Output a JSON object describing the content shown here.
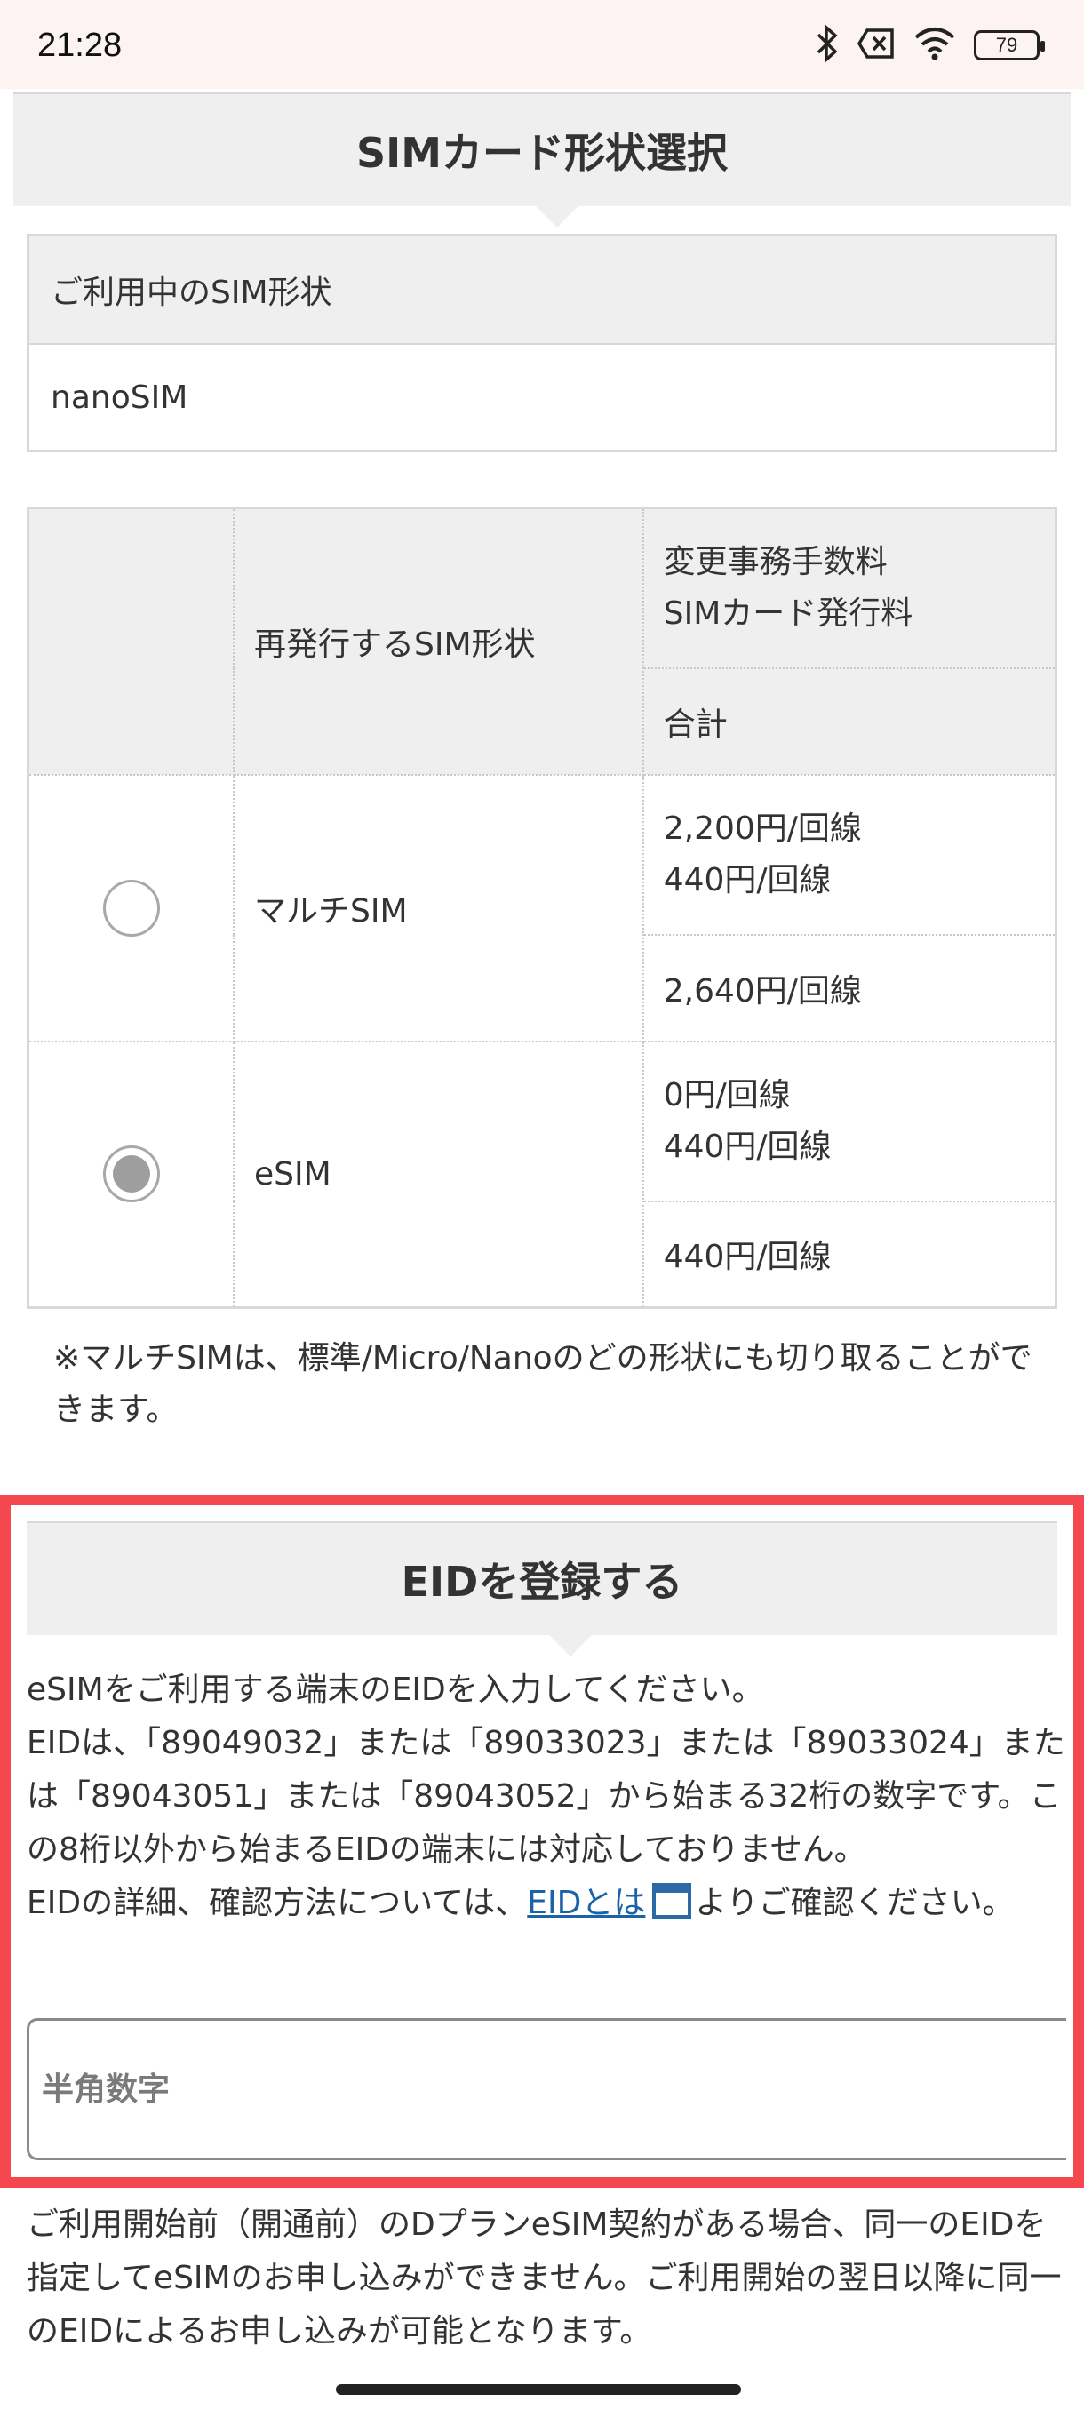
{
  "status_bar": {
    "time": "21:28",
    "battery": "79",
    "icons": [
      "bluetooth-icon",
      "no-sim-icon",
      "wifi-icon",
      "battery-icon"
    ]
  },
  "sim_shape_section": {
    "title": "SIMカード形状選択",
    "current_label": "ご利用中のSIM形状",
    "current_value": "nanoSIM"
  },
  "sim_table": {
    "col_shape": "再発行するSIM形状",
    "col_fee_line1": "変更事務手数料",
    "col_fee_line2": "SIMカード発行料",
    "col_total": "合計",
    "rows": [
      {
        "name": "マルチSIM",
        "selected": false,
        "fee1": "2,200円/回線",
        "fee2": "440円/回線",
        "total": "2,640円/回線"
      },
      {
        "name": "eSIM",
        "selected": true,
        "fee1": "0円/回線",
        "fee2": "440円/回線",
        "total": "440円/回線"
      }
    ]
  },
  "note": "※マルチSIMは、標準/Micro/Nanoのどの形状にも切り取ることができます。",
  "eid_section": {
    "title": "EIDを登録する",
    "desc_line1": "eSIMをご利用する端末のEIDを入力してください。",
    "desc_line2": "EIDは、「89049032」または「89033023」または「89033024」または「89043051」または「89043052」から始まる32桁の数字です。この8桁以外から始まるEIDの端末には対応しておりません。",
    "desc_line3_pre": "EIDの詳細、確認方法については、",
    "desc_link": "EIDとは",
    "desc_line3_post": "よりご確認ください。",
    "input_placeholder": "半角数字",
    "input_value": ""
  },
  "bottom_note": "ご利用開始前（開通前）のDプランeSIM契約がある場合、同一のEIDを指定してeSIMのお申し込みができません。ご利用開始の翌日以降に同一のEIDによるお申し込みが可能となります。",
  "colors": {
    "highlight_border": "#f4474f",
    "header_bg": "#efefef",
    "link": "#1a63a8"
  }
}
